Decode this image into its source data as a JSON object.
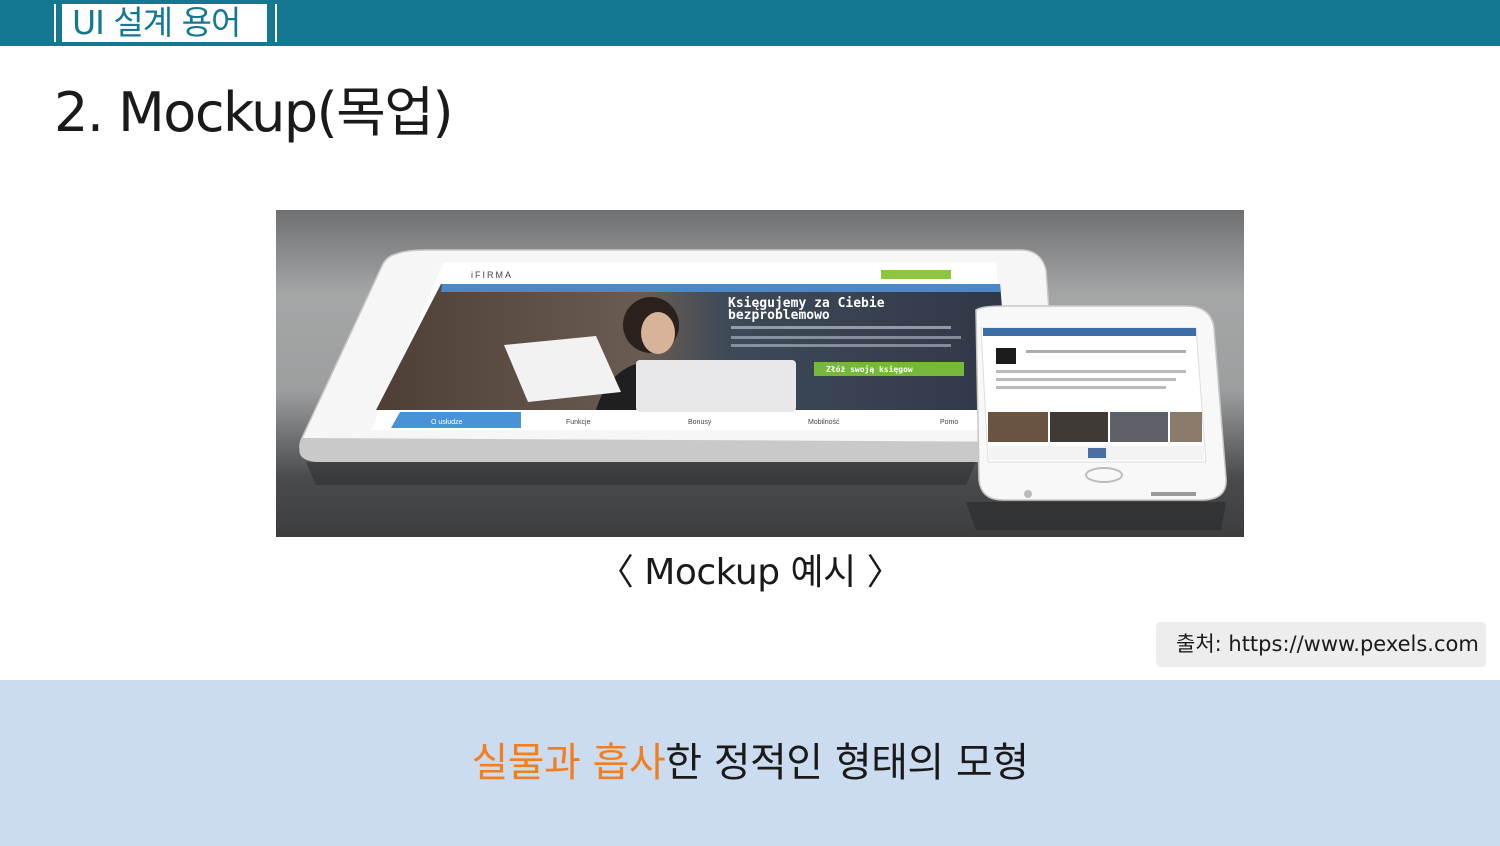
{
  "header": {
    "section_tag": "UI 설계 용어",
    "bar_color": "#157893"
  },
  "slide": {
    "title": "2. Mockup(목업)",
    "image": {
      "tablet_screen": {
        "logo": "iFIRMA",
        "headline_line1": "Księgujemy za Ciebie",
        "headline_line2": "bezproblemowo",
        "cta_button": "Złóż swoją księgow",
        "tabs": [
          "O usłudze",
          "Funkcje",
          "Bonusy",
          "Mobilność",
          "Pomo"
        ]
      }
    },
    "caption": "〈 Mockup 예시 〉",
    "source": "출처: https://www.pexels.com",
    "definition": {
      "highlight_1": "실물과",
      "space": " ",
      "highlight_2": "흡사",
      "rest": "한 정적인 형태의 모형",
      "highlight_color": "#f07f21"
    },
    "band_color": "#ccdcf0"
  }
}
